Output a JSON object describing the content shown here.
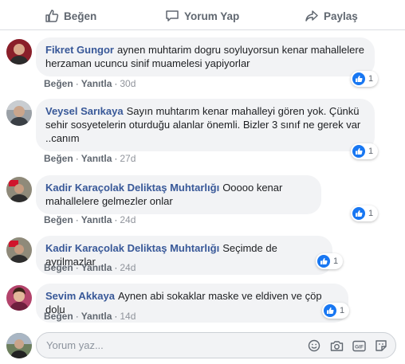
{
  "actions": {
    "like": "Beğen",
    "comment": "Yorum Yap",
    "share": "Paylaş"
  },
  "comment_meta": {
    "like": "Beğen",
    "reply": "Yanıtla",
    "sep": "·"
  },
  "comments": [
    {
      "author": "Fikret Gungor",
      "text": "aynen muhtarim dogru soyluyorsun kenar mahallelere herzaman ucuncu sinif muamelesi yapiyorlar",
      "time": "30d",
      "reactions": "1"
    },
    {
      "author": "Veysel Sarıkaya",
      "text": "Sayın muhtarım kenar mahalleyi gören yok. Çünkü sehir sosyetelerin oturduğu alanlar önemli. Bizler 3 sınıf ne gerek var ..canım",
      "time": "27d",
      "reactions": "1"
    },
    {
      "author": "Kadir Karaçolak Deliktaş Muhtarlığı",
      "text": "Ooooo kenar mahallelere gelmezler onlar",
      "time": "24d",
      "reactions": "1"
    },
    {
      "author": "Kadir Karaçolak Deliktaş Muhtarlığı",
      "text": "Seçimde de ayrilmazlar",
      "time": "24d",
      "reactions": "1"
    },
    {
      "author": "Sevim Akkaya",
      "text": "Aynen abi sokaklar maske ve eldiven ve çöp dolu",
      "time": "14d",
      "reactions": "1"
    }
  ],
  "composer": {
    "placeholder": "Yorum yaz...",
    "tools": [
      "emoji-icon",
      "camera-icon",
      "gif-icon",
      "sticker-icon"
    ]
  },
  "colors": {
    "author": "#385898",
    "bubble": "#f2f3f5",
    "like_blue": "#1877f2",
    "muted": "#606770"
  }
}
